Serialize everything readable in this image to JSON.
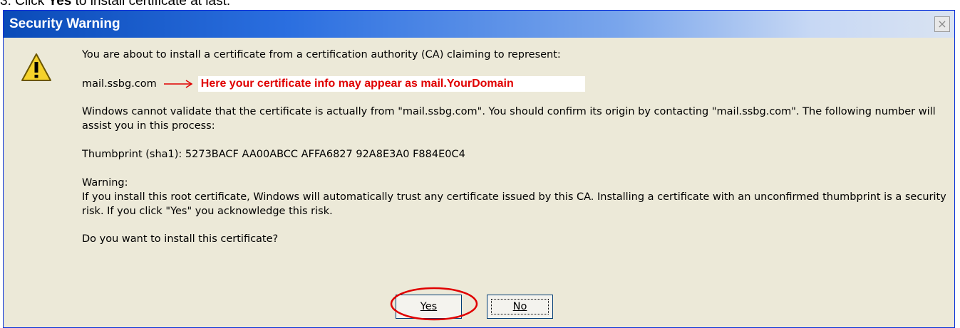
{
  "instruction": {
    "prefix": "3.   Click ",
    "bold": "Yes",
    "suffix": " to install certificate at last."
  },
  "dialog": {
    "title": "Security Warning",
    "close_glyph": "×",
    "icon": "warning-icon",
    "prompt": "You are about to install a certificate from a certification authority (CA) claiming to represent:",
    "domain": "mail.ssbg.com",
    "annotation": "Here your certificate info may appear as mail.YourDomain",
    "validate_text": "Windows cannot validate that the certificate is actually from \"mail.ssbg.com\". You should confirm its origin by contacting \"mail.ssbg.com\". The following number will assist you in this process:",
    "thumbprint": "Thumbprint (sha1): 5273BACF AA00ABCC AFFA6827 92A8E3A0 F884E0C4",
    "warning_heading": "Warning:",
    "warning_text": "If you install this root certificate, Windows will automatically trust any certificate issued by this CA. Installing a certificate with an unconfirmed thumbprint is a security risk. If you click \"Yes\" you acknowledge this risk.",
    "question": "Do you want to install this certificate?",
    "buttons": {
      "yes_label": "Yes",
      "no_label": "No"
    }
  },
  "colors": {
    "titlebar_start": "#0a4bb8",
    "dialog_bg": "#ece9d8",
    "annotation": "#e00000"
  }
}
